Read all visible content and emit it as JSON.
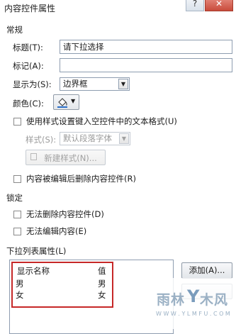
{
  "window": {
    "title": "内容控件属性",
    "minimize_glyph": "?",
    "close_glyph": "✕"
  },
  "general": {
    "heading": "常规",
    "title_label": "标题(T):",
    "title_value": "请下拉选择",
    "tag_label": "标记(A):",
    "tag_value": "",
    "show_as_label": "显示为(S):",
    "show_as_value": "边界框",
    "color_label": "颜色(C):",
    "use_style_label": "使用样式设置键入空控件中的文本格式(U)",
    "style_label": "样式(S):",
    "style_value": "默认段落字体",
    "new_style_label": "新建样式(N)...",
    "remove_when_edited_label": "内容被编辑后删除内容控件(R)"
  },
  "locking": {
    "heading": "锁定",
    "cannot_delete_label": "无法删除内容控件(D)",
    "cannot_edit_label": "无法编辑内容(E)"
  },
  "dropdown": {
    "heading": "下拉列表属性(L)",
    "columns": {
      "display_name": "显示名称",
      "value": "值"
    },
    "items": [
      {
        "display_name": "男",
        "value": "男"
      },
      {
        "display_name": "女",
        "value": "女"
      }
    ],
    "add_label": "添加(A)..."
  },
  "watermark": {
    "line1": "雨林",
    "line1_icon": "Y",
    "line2": "木风",
    "url": "W W W . Y L M F U . C O M"
  },
  "colors": {
    "highlight": "#c62828",
    "accent": "#2a6fc9"
  }
}
